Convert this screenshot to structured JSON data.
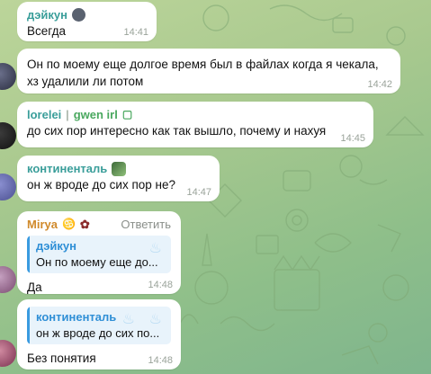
{
  "colors": {
    "name_teal": "#3a9e9a",
    "name_green": "#4aa85f",
    "name_orange": "#d08a2b",
    "quote_blue": "#2f8fd6",
    "bubble": "#ffffff",
    "background": "#a9c98f"
  },
  "messages": [
    {
      "sender": "дэйкун",
      "text": "Всегда",
      "time": "14:41"
    },
    {
      "sender": "",
      "text": "Он по моему еще долгое время был в файлах когда я чекала, хз удалили ли потом",
      "time": "14:42"
    },
    {
      "sender": "lorelei",
      "sender_title": "gwen irl",
      "text": "до сих пор интересно как так вышло, почему и нахуя",
      "time": "14:45"
    },
    {
      "sender": "континенталь",
      "text": "он ж вроде до сих пор не?",
      "time": "14:47"
    },
    {
      "sender": "Mirya",
      "reply_button": "Ответить",
      "quote_sender": "дэйкун",
      "quote_text": "Он по моему еще до...",
      "text": "Да",
      "time": "14:48"
    },
    {
      "sender": "",
      "quote_sender": "континенталь",
      "quote_text": "он ж вроде до сих по...",
      "text": "Без понятия",
      "time": "14:48"
    }
  ]
}
